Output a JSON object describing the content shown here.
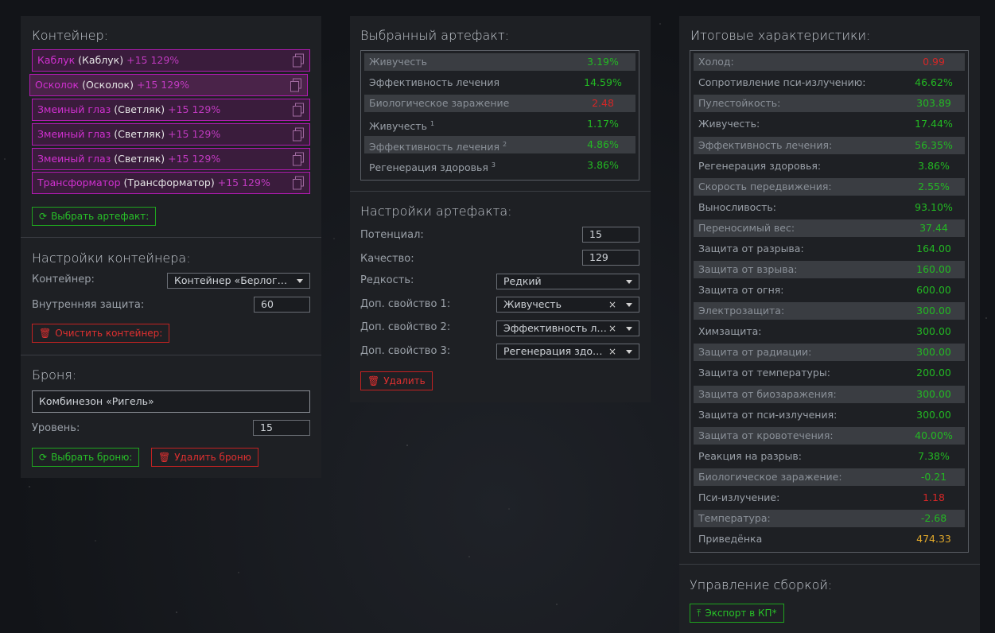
{
  "container_panel": {
    "title": "Контейнер:",
    "items": [
      {
        "name": "Каблук",
        "type": "(Каблук)",
        "bonus": "+15 129%"
      },
      {
        "name": "Осколок",
        "type": "(Осколок)",
        "bonus": "+15 129%"
      },
      {
        "name": "Змеиный глаз",
        "type": "(Светляк)",
        "bonus": "+15 129%"
      },
      {
        "name": "Змеиный глаз",
        "type": "(Светляк)",
        "bonus": "+15 129%"
      },
      {
        "name": "Змеиный глаз",
        "type": "(Светляк)",
        "bonus": "+15 129%"
      },
      {
        "name": "Трансформатор",
        "type": "(Трансформатор)",
        "bonus": "+15 129%"
      }
    ],
    "select_artifact_btn": "Выбрать артефакт:",
    "settings_title": "Настройки контейнера:",
    "container_label": "Контейнер:",
    "container_value": "Контейнер «Берлог…",
    "inner_protection_label": "Внутренняя защита:",
    "inner_protection_value": "60",
    "clear_btn": "Очистить контейнер:",
    "armor_title": "Броня:",
    "armor_value": "Комбинезон «Ригель»",
    "level_label": "Уровень:",
    "level_value": "15",
    "select_armor_btn": "Выбрать броню:",
    "delete_armor_btn": "Удалить броню"
  },
  "artifact_panel": {
    "title": "Выбранный артефакт:",
    "stats": [
      {
        "label": "Живучесть",
        "sup": "",
        "value": "3.19%",
        "color": "g"
      },
      {
        "label": "Эффективность лечения",
        "sup": "",
        "value": "14.59%",
        "color": "g"
      },
      {
        "label": "Биологическое заражение",
        "sup": "",
        "value": "2.48",
        "color": "r"
      },
      {
        "label": "Живучесть",
        "sup": "1",
        "value": "1.17%",
        "color": "g"
      },
      {
        "label": "Эффективность лечения",
        "sup": "2",
        "value": "4.86%",
        "color": "g"
      },
      {
        "label": "Регенерация здоровья",
        "sup": "3",
        "value": "3.86%",
        "color": "g"
      }
    ],
    "settings_title": "Настройки артефакта:",
    "potential_label": "Потенциал:",
    "potential_value": "15",
    "quality_label": "Качество:",
    "quality_value": "129",
    "rarity_label": "Редкость:",
    "rarity_value": "Редкий",
    "prop1_label": "Доп. свойство 1:",
    "prop1_value": "Живучесть",
    "prop2_label": "Доп. свойство 2:",
    "prop2_value": "Эффективность л…",
    "prop3_label": "Доп. свойство 3:",
    "prop3_value": "Регенерация здо…",
    "clear_symbol": "×",
    "delete_btn": "Удалить"
  },
  "totals_panel": {
    "title": "Итоговые характеристики:",
    "stats": [
      {
        "label": "Холод:",
        "value": "0.99",
        "color": "r"
      },
      {
        "label": "Сопротивление пси-излучению:",
        "value": "46.62%",
        "color": "g"
      },
      {
        "label": "Пулестойкость:",
        "value": "303.89",
        "color": "g"
      },
      {
        "label": "Живучесть:",
        "value": "17.44%",
        "color": "g"
      },
      {
        "label": "Эффективность лечения:",
        "value": "56.35%",
        "color": "g"
      },
      {
        "label": "Регенерация здоровья:",
        "value": "3.86%",
        "color": "g"
      },
      {
        "label": "Скорость передвижения:",
        "value": "2.55%",
        "color": "g"
      },
      {
        "label": "Выносливость:",
        "value": "93.10%",
        "color": "g"
      },
      {
        "label": "Переносимый вес:",
        "value": "37.44",
        "color": "g"
      },
      {
        "label": "Защита от разрыва:",
        "value": "164.00",
        "color": "g"
      },
      {
        "label": "Защита от взрыва:",
        "value": "160.00",
        "color": "g"
      },
      {
        "label": "Защита от огня:",
        "value": "600.00",
        "color": "g"
      },
      {
        "label": "Электрозащита:",
        "value": "300.00",
        "color": "g"
      },
      {
        "label": "Химзащита:",
        "value": "300.00",
        "color": "g"
      },
      {
        "label": "Защита от радиации:",
        "value": "300.00",
        "color": "g"
      },
      {
        "label": "Защита от температуры:",
        "value": "200.00",
        "color": "g"
      },
      {
        "label": "Защита от биозаражения:",
        "value": "300.00",
        "color": "g"
      },
      {
        "label": "Защита от пси-излучения:",
        "value": "300.00",
        "color": "g"
      },
      {
        "label": "Защита от кровотечения:",
        "value": "40.00%",
        "color": "g"
      },
      {
        "label": "Реакция на разрыв:",
        "value": "7.38%",
        "color": "g"
      },
      {
        "label": "Биологическое заражение:",
        "value": "-0.21",
        "color": "g"
      },
      {
        "label": "Пси-излучение:",
        "value": "1.18",
        "color": "r"
      },
      {
        "label": "Температура:",
        "value": "-2.68",
        "color": "g"
      },
      {
        "label": "Приведёнка",
        "value": "474.33",
        "color": "y"
      }
    ],
    "build_title": "Управление сборкой:",
    "export_btn": "Экспорт в КП*"
  },
  "colors": {
    "positive": "#23b823",
    "negative": "#d42727",
    "highlight": "#e0a82a",
    "container_accent": "#b21bb2"
  }
}
